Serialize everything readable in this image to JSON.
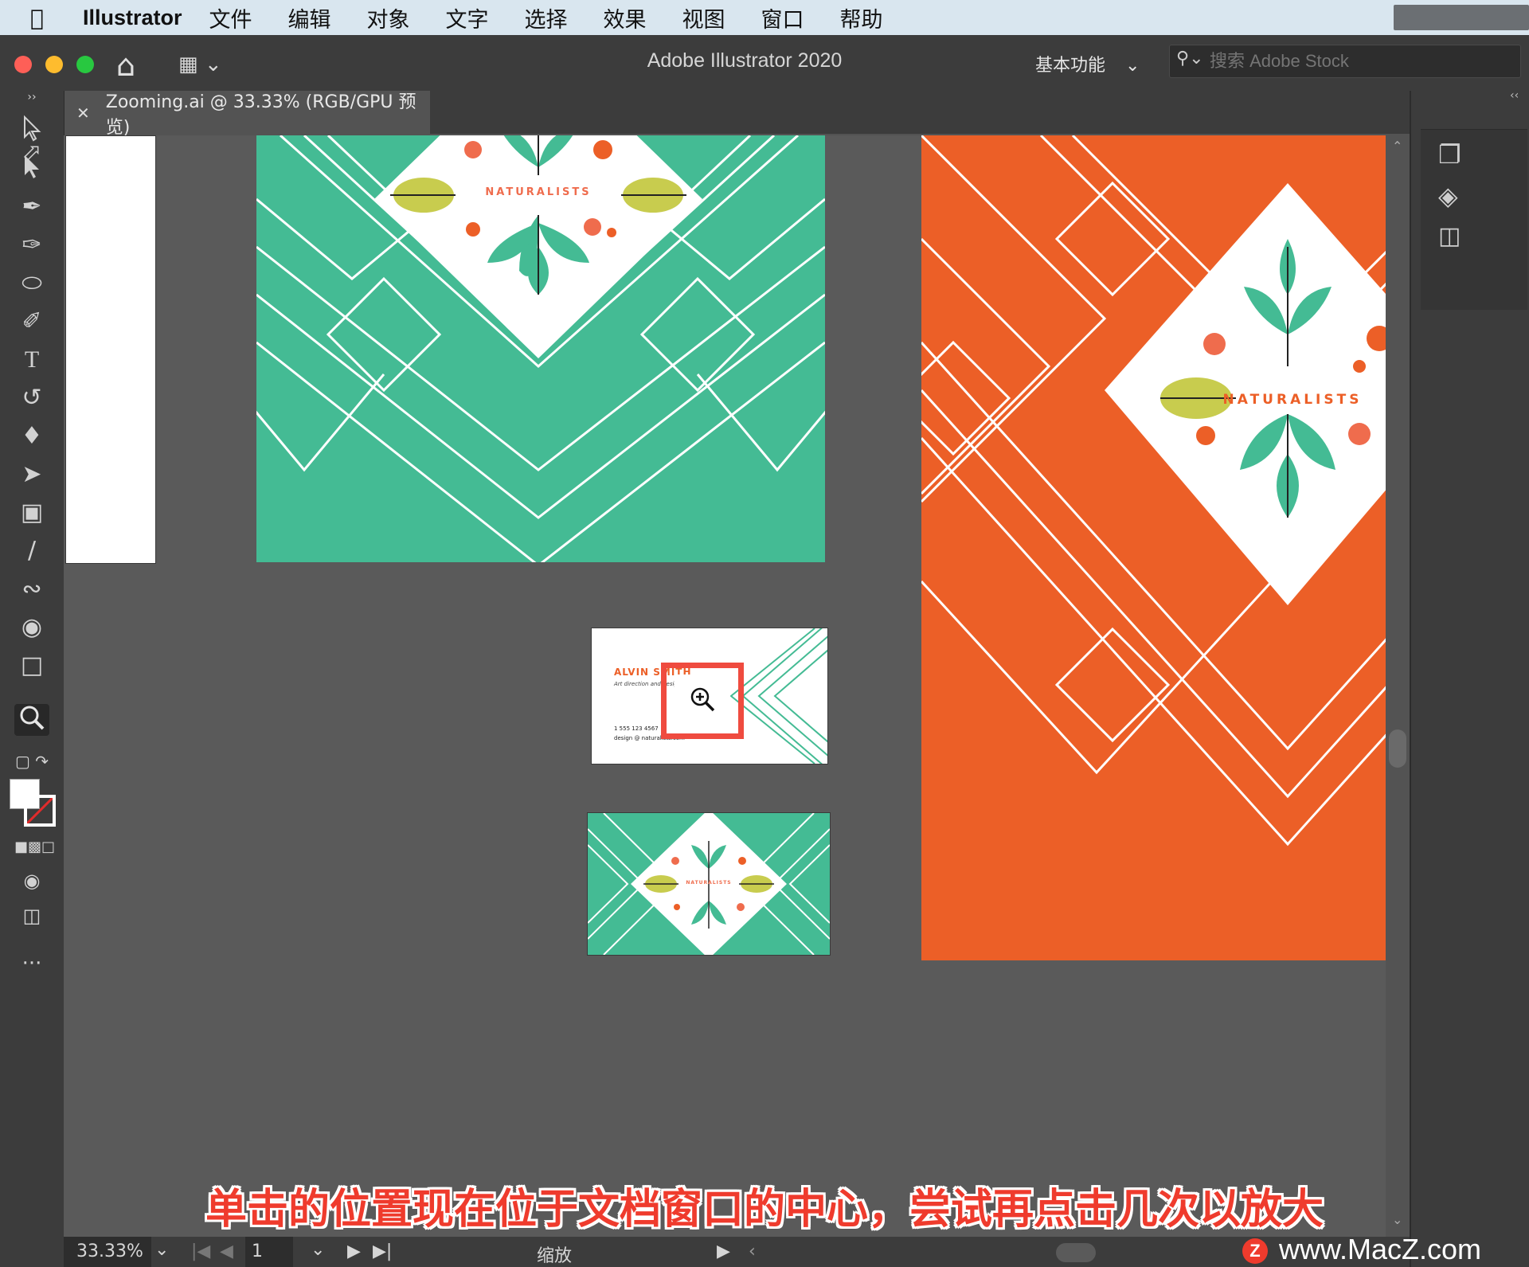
{
  "menubar": {
    "app_name": "Illustrator",
    "items": [
      "文件",
      "编辑",
      "对象",
      "文字",
      "选择",
      "效果",
      "视图",
      "窗口",
      "帮助"
    ]
  },
  "titlebar": {
    "window_title": "Adobe Illustrator 2020",
    "workspace_label": "基本功能",
    "search_placeholder": "搜索 Adobe Stock"
  },
  "document_tab": {
    "label": "Zooming.ai @ 33.33% (RGB/GPU 预览)"
  },
  "artwork": {
    "brand_text": "NATURALISTS",
    "card_name": "ALVIN SMITH",
    "card_role": "Art direction and design",
    "card_phone": "1 555 123 4567",
    "card_email": "design @ naturalists.com",
    "colors": {
      "teal": "#44bb94",
      "orange": "#ec5f27",
      "lime": "#c8cc4e",
      "coral": "#ef6c4d"
    }
  },
  "statusbar": {
    "zoom": "33.33%",
    "artboard_number": "1",
    "tool_name": "缩放"
  },
  "caption": "单击的位置现在位于文档窗口的中心，尝试再点击几次以放大",
  "watermark": "www.MacZ.com",
  "watermark_badge": "Z",
  "highlight_color": "#ef4b3f"
}
